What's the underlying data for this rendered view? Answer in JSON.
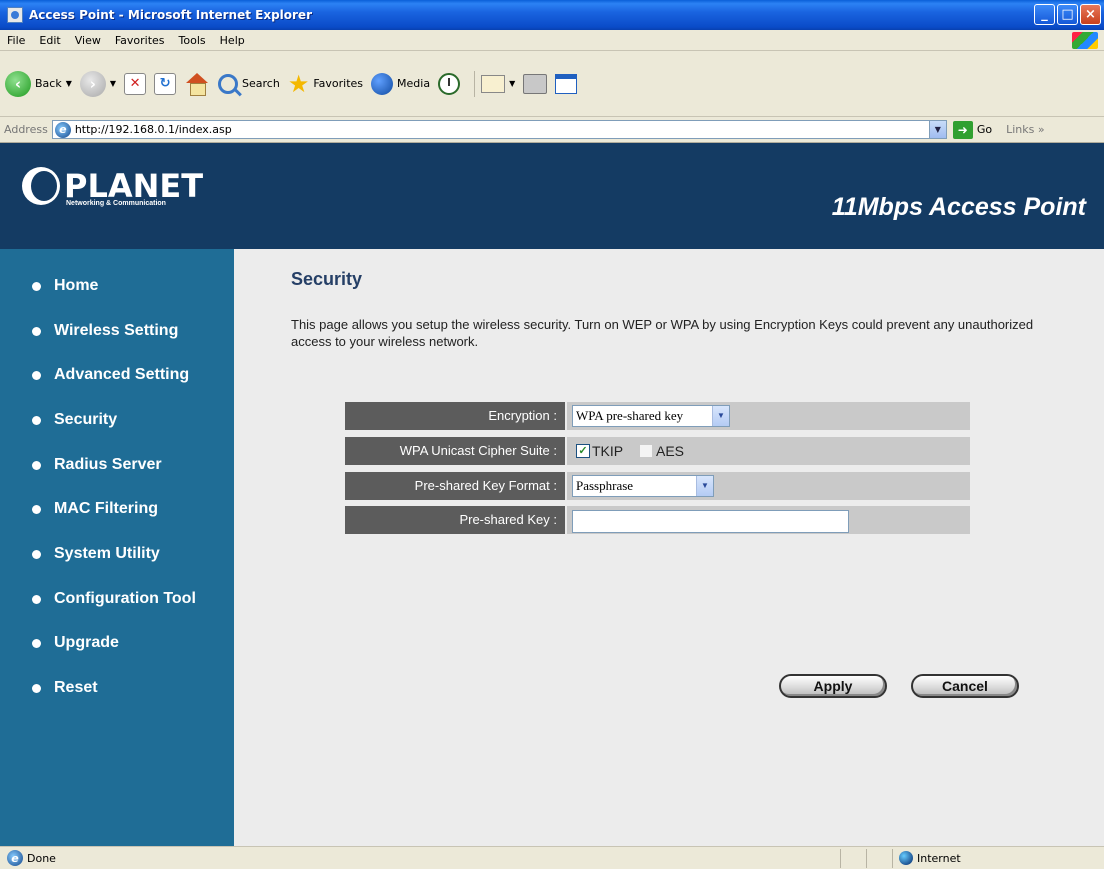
{
  "window": {
    "title": "Access Point - Microsoft Internet Explorer"
  },
  "menu": [
    "File",
    "Edit",
    "View",
    "Favorites",
    "Tools",
    "Help"
  ],
  "toolbar": {
    "back": "Back",
    "search": "Search",
    "favorites": "Favorites",
    "media": "Media"
  },
  "address": {
    "label": "Address",
    "url": "http://192.168.0.1/index.asp",
    "go": "Go",
    "links": "Links"
  },
  "banner": {
    "brand": "PLANET",
    "tagline": "Networking & Communication",
    "product": "11Mbps Access Point"
  },
  "nav": [
    "Home",
    "Wireless Setting",
    "Advanced Setting",
    "Security",
    "Radius Server",
    "MAC Filtering",
    "System Utility",
    "Configuration Tool",
    "Upgrade",
    "Reset"
  ],
  "main": {
    "heading": "Security",
    "description": "This page allows you setup the wireless security. Turn on WEP or WPA by using Encryption Keys could prevent any unauthorized access to your wireless network."
  },
  "form": {
    "encryption_label": "Encryption :",
    "encryption_value": "WPA pre-shared key",
    "cipher_label": "WPA Unicast Cipher Suite :",
    "tkip_label": "TKIP",
    "tkip_checked": true,
    "aes_label": "AES",
    "aes_checked": false,
    "key_format_label": "Pre-shared Key Format :",
    "key_format_value": "Passphrase",
    "key_label": "Pre-shared Key :",
    "key_value": ""
  },
  "buttons": {
    "apply": "Apply",
    "cancel": "Cancel"
  },
  "status": {
    "text": "Done",
    "zone": "Internet"
  }
}
